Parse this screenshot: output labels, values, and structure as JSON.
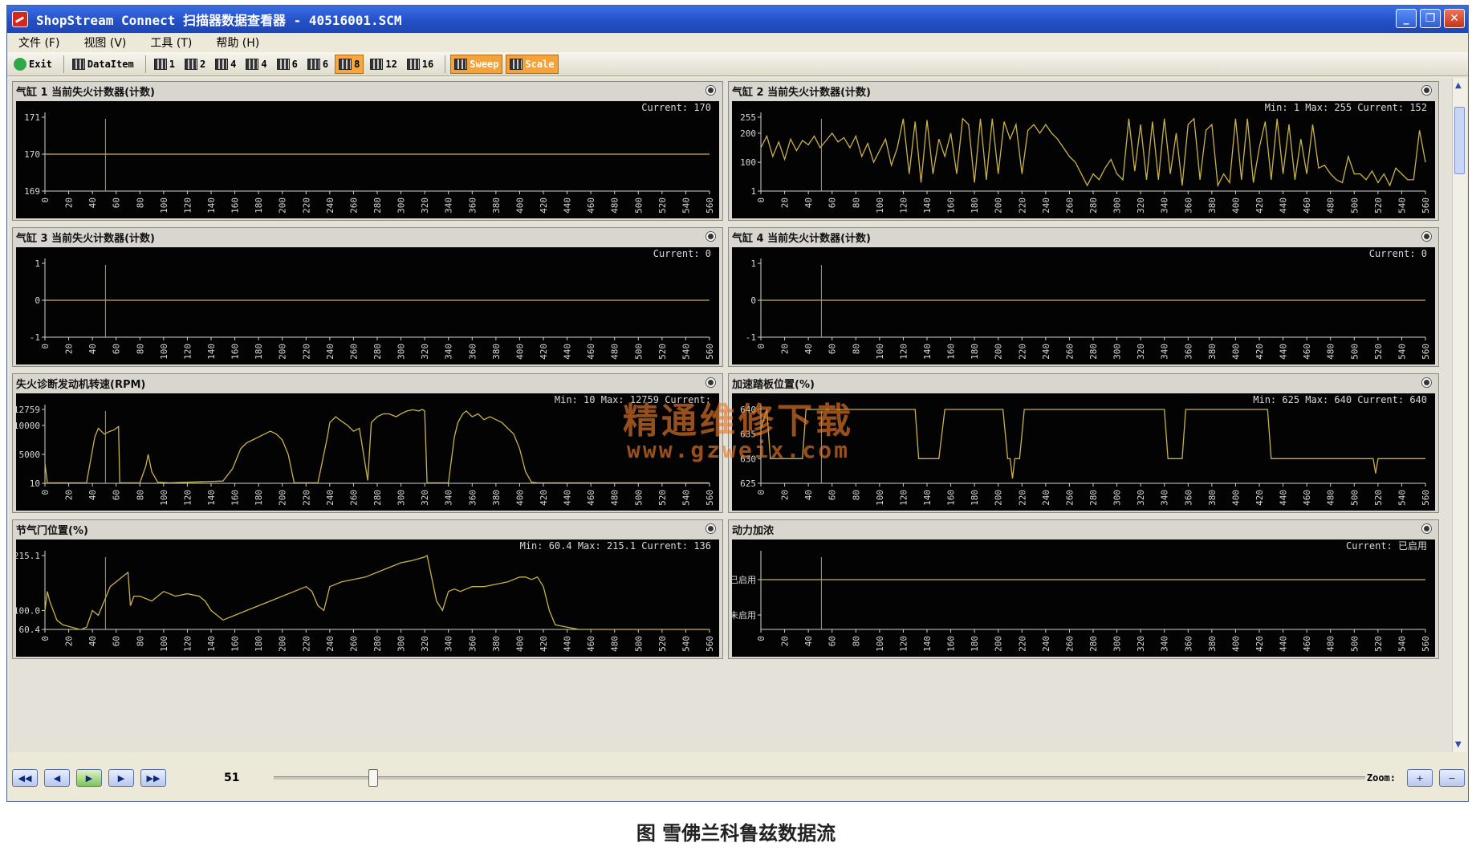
{
  "window": {
    "title": "ShopStream Connect 扫描器数据查看器 - 40516001.SCM"
  },
  "menu": [
    "文件 (F)",
    "视图 (V)",
    "工具 (T)",
    "帮助 (H)"
  ],
  "toolbar": {
    "exit": "Exit",
    "dataitem": "DataItem",
    "layouts": [
      "1",
      "2",
      "4",
      "4",
      "6",
      "6",
      "8",
      "12",
      "16"
    ],
    "active_layout_index": 6,
    "sweep": "Sweep",
    "scale": "Scale"
  },
  "panels": [
    {
      "title": "气缸 1 当前失火计数器(计数)",
      "stats": "Current: 170"
    },
    {
      "title": "气缸 2 当前失火计数器(计数)",
      "stats": "Min: 1     Max: 255     Current: 152"
    },
    {
      "title": "气缸 3 当前失火计数器(计数)",
      "stats": "Current: 0"
    },
    {
      "title": "气缸 4 当前失火计数器(计数)",
      "stats": "Current: 0"
    },
    {
      "title": "失火诊断发动机转速(RPM)",
      "stats": "Min: 10     Max: 12759     Current:"
    },
    {
      "title": "加速踏板位置(%)",
      "stats": "Min: 625     Max: 640     Current: 640"
    },
    {
      "title": "节气门位置(%)",
      "stats": "Min: 60.4     Max: 215.1     Current: 136"
    },
    {
      "title": "动力加浓",
      "stats": "Current: 已启用"
    }
  ],
  "chart_data": [
    {
      "type": "line",
      "title": "气缸 1 当前失火计数器(计数)",
      "x_ticks": [
        0,
        20,
        40,
        60,
        80,
        100,
        120,
        140,
        160,
        180,
        200,
        220,
        240,
        260,
        280,
        300,
        320,
        340,
        360,
        380,
        400,
        420,
        440,
        460,
        480,
        500,
        520,
        540,
        560
      ],
      "y_ticks": [
        "171",
        "170",
        "169"
      ],
      "ylim": [
        169,
        171
      ],
      "cursor_x": 51,
      "series": [
        {
          "x": [
            0,
            560
          ],
          "values": [
            170,
            170
          ]
        }
      ]
    },
    {
      "type": "line",
      "title": "气缸 2 当前失火计数器(计数)",
      "x_ticks": [
        0,
        20,
        40,
        60,
        80,
        100,
        120,
        140,
        160,
        180,
        200,
        220,
        240,
        260,
        280,
        300,
        320,
        340,
        360,
        380,
        400,
        420,
        440,
        460,
        480,
        500,
        520,
        540,
        560
      ],
      "y_ticks": [
        "255",
        "200",
        "100",
        "1"
      ],
      "ylim": [
        1,
        255
      ],
      "cursor_x": 51,
      "series": [
        {
          "x": [
            0,
            5,
            10,
            15,
            20,
            25,
            30,
            35,
            40,
            45,
            50,
            55,
            60,
            65,
            70,
            75,
            80,
            85,
            90,
            95,
            100,
            105,
            110,
            115,
            120,
            125,
            130,
            135,
            140,
            145,
            150,
            155,
            160,
            165,
            170,
            175,
            180,
            185,
            190,
            195,
            200,
            205,
            210,
            215,
            220,
            225,
            230,
            235,
            240,
            245,
            250,
            255,
            260,
            265,
            270,
            275,
            280,
            285,
            290,
            295,
            300,
            305,
            310,
            315,
            320,
            325,
            330,
            335,
            340,
            345,
            350,
            355,
            360,
            365,
            370,
            375,
            380,
            385,
            390,
            395,
            400,
            405,
            410,
            415,
            420,
            425,
            430,
            435,
            440,
            445,
            450,
            455,
            460,
            465,
            470,
            475,
            480,
            485,
            490,
            495,
            500,
            505,
            510,
            515,
            520,
            525,
            530,
            535,
            540,
            545,
            550,
            555,
            560
          ],
          "values": [
            150,
            190,
            120,
            170,
            110,
            180,
            140,
            175,
            160,
            190,
            150,
            175,
            200,
            170,
            185,
            150,
            190,
            120,
            165,
            100,
            140,
            180,
            90,
            150,
            250,
            60,
            240,
            30,
            245,
            60,
            180,
            120,
            200,
            60,
            250,
            230,
            30,
            250,
            40,
            250,
            60,
            240,
            180,
            230,
            60,
            210,
            230,
            200,
            230,
            200,
            180,
            150,
            120,
            100,
            60,
            20,
            60,
            40,
            80,
            110,
            60,
            40,
            250,
            70,
            230,
            40,
            240,
            40,
            250,
            60,
            200,
            20,
            230,
            250,
            40,
            210,
            230,
            20,
            60,
            30,
            250,
            40,
            250,
            30,
            150,
            240,
            40,
            250,
            60,
            230,
            40,
            180,
            60,
            230,
            80,
            90,
            60,
            40,
            30,
            120,
            60,
            60,
            40,
            70,
            30,
            60,
            20,
            80,
            60,
            40,
            40,
            210,
            100
          ]
        }
      ]
    },
    {
      "type": "line",
      "title": "气缸 3 当前失火计数器(计数)",
      "x_ticks": [
        0,
        20,
        40,
        60,
        80,
        100,
        120,
        140,
        160,
        180,
        200,
        220,
        240,
        260,
        280,
        300,
        320,
        340,
        360,
        380,
        400,
        420,
        440,
        460,
        480,
        500,
        520,
        540,
        560
      ],
      "y_ticks": [
        "1",
        "0",
        "-1"
      ],
      "ylim": [
        -1,
        1
      ],
      "cursor_x": 51,
      "series": [
        {
          "x": [
            0,
            560
          ],
          "values": [
            0,
            0
          ]
        }
      ]
    },
    {
      "type": "line",
      "title": "气缸 4 当前失火计数器(计数)",
      "x_ticks": [
        0,
        20,
        40,
        60,
        80,
        100,
        120,
        140,
        160,
        180,
        200,
        220,
        240,
        260,
        280,
        300,
        320,
        340,
        360,
        380,
        400,
        420,
        440,
        460,
        480,
        500,
        520,
        540,
        560
      ],
      "y_ticks": [
        "1",
        "0",
        "-1"
      ],
      "ylim": [
        -1,
        1
      ],
      "cursor_x": 51,
      "series": [
        {
          "x": [
            0,
            560
          ],
          "values": [
            0,
            0
          ]
        }
      ]
    },
    {
      "type": "line",
      "title": "失火诊断发动机转速(RPM)",
      "x_ticks": [
        0,
        20,
        40,
        60,
        80,
        100,
        120,
        140,
        160,
        180,
        200,
        220,
        240,
        260,
        280,
        300,
        320,
        340,
        360,
        380,
        400,
        420,
        440,
        460,
        480,
        500,
        520,
        540,
        560
      ],
      "y_ticks": [
        "12759",
        "10000",
        "5000",
        "10"
      ],
      "ylim": [
        10,
        12759
      ],
      "cursor_x": 51,
      "series": [
        {
          "x": [
            0,
            2,
            3,
            35,
            42,
            45,
            50,
            55,
            58,
            62,
            63,
            80,
            85,
            87,
            90,
            95,
            105,
            150,
            158,
            165,
            170,
            175,
            180,
            185,
            190,
            195,
            200,
            205,
            210,
            230,
            238,
            240,
            245,
            248,
            255,
            260,
            265,
            272,
            275,
            280,
            285,
            290,
            296,
            300,
            305,
            310,
            315,
            318,
            320,
            322,
            340,
            345,
            348,
            352,
            355,
            360,
            365,
            370,
            375,
            380,
            385,
            390,
            395,
            400,
            405,
            410,
            415,
            420,
            560
          ],
          "values": [
            3500,
            10,
            100,
            100,
            8000,
            9500,
            8500,
            9000,
            9200,
            9800,
            100,
            100,
            3000,
            5000,
            2000,
            200,
            100,
            400,
            2500,
            6000,
            7000,
            7500,
            8000,
            8500,
            9000,
            8500,
            7500,
            5000,
            100,
            100,
            8000,
            10500,
            11500,
            11000,
            10000,
            9000,
            9500,
            500,
            10500,
            11500,
            12000,
            12000,
            11500,
            12000,
            12500,
            12700,
            12500,
            12759,
            12500,
            100,
            100,
            8000,
            10500,
            12000,
            12500,
            11500,
            12000,
            11000,
            11500,
            11000,
            10500,
            9500,
            8500,
            6000,
            2000,
            200,
            100,
            100,
            100
          ]
        }
      ]
    },
    {
      "type": "line",
      "title": "加速踏板位置(%)",
      "x_ticks": [
        0,
        20,
        40,
        60,
        80,
        100,
        120,
        140,
        160,
        180,
        200,
        220,
        240,
        260,
        280,
        300,
        320,
        340,
        360,
        380,
        400,
        420,
        440,
        460,
        480,
        500,
        520,
        540,
        560
      ],
      "y_ticks": [
        "640",
        "635",
        "630",
        "625"
      ],
      "ylim": [
        625,
        640
      ],
      "cursor_x": 51,
      "series": [
        {
          "x": [
            0,
            5,
            8,
            35,
            38,
            48,
            52,
            130,
            133,
            150,
            155,
            204,
            208,
            210,
            212,
            214,
            218,
            222,
            225,
            227,
            340,
            343,
            355,
            358,
            427,
            430,
            516,
            518,
            520,
            560
          ],
          "values": [
            636,
            640,
            630,
            630,
            640,
            640,
            640,
            640,
            630,
            630,
            640,
            640,
            630,
            630,
            626,
            630,
            630,
            640,
            640,
            640,
            640,
            630,
            630,
            640,
            640,
            630,
            630,
            627,
            630,
            630
          ]
        }
      ]
    },
    {
      "type": "line",
      "title": "节气门位置(%)",
      "x_ticks": [
        0,
        20,
        40,
        60,
        80,
        100,
        120,
        140,
        160,
        180,
        200,
        220,
        240,
        260,
        280,
        300,
        320,
        340,
        360,
        380,
        400,
        420,
        440,
        460,
        480,
        500,
        520,
        540,
        560
      ],
      "y_ticks": [
        "215.1",
        "100.0",
        "60.4"
      ],
      "ylim": [
        60.4,
        215.1
      ],
      "cursor_x": 51,
      "series": [
        {
          "x": [
            0,
            2,
            4,
            10,
            15,
            30,
            35,
            40,
            45,
            50,
            55,
            60,
            65,
            70,
            72,
            75,
            80,
            90,
            100,
            110,
            120,
            130,
            135,
            140,
            150,
            160,
            170,
            180,
            190,
            200,
            210,
            220,
            225,
            230,
            235,
            240,
            250,
            260,
            270,
            280,
            290,
            300,
            310,
            320,
            322,
            325,
            330,
            335,
            340,
            345,
            350,
            360,
            370,
            380,
            390,
            400,
            405,
            410,
            415,
            420,
            425,
            430,
            440,
            450,
            560
          ],
          "values": [
            100,
            140,
            120,
            80,
            70,
            60,
            65,
            100,
            90,
            120,
            150,
            160,
            170,
            180,
            110,
            130,
            130,
            120,
            140,
            130,
            135,
            130,
            120,
            100,
            80,
            90,
            100,
            110,
            120,
            130,
            140,
            150,
            140,
            110,
            100,
            150,
            160,
            165,
            170,
            180,
            190,
            200,
            205,
            212,
            215.1,
            180,
            120,
            100,
            140,
            145,
            140,
            150,
            150,
            155,
            160,
            170,
            170,
            165,
            170,
            150,
            100,
            70,
            65,
            60.4,
            60.4
          ]
        }
      ]
    },
    {
      "type": "line",
      "title": "动力加浓",
      "x_ticks": [
        0,
        20,
        40,
        60,
        80,
        100,
        120,
        140,
        160,
        180,
        200,
        220,
        240,
        260,
        280,
        300,
        320,
        340,
        360,
        380,
        400,
        420,
        440,
        460,
        480,
        500,
        520,
        540,
        560
      ],
      "y_ticks": [
        "已启用",
        "未启用"
      ],
      "ylim": [
        0,
        1
      ],
      "cursor_x": 51,
      "series": [
        {
          "x": [
            0,
            560
          ],
          "values": [
            1,
            1
          ]
        }
      ]
    }
  ],
  "playback": {
    "frame": "51",
    "zoom_label": "Zoom:"
  },
  "watermark": {
    "line1": "精通维修下载",
    "line2": "www.gzweix.com"
  },
  "caption": "图 雪佛兰科鲁兹数据流",
  "colors": {
    "trace": "#c9b24a",
    "cursor": "#b8a040",
    "grid": "#cfcfcf",
    "plot_bg": "#030303"
  }
}
